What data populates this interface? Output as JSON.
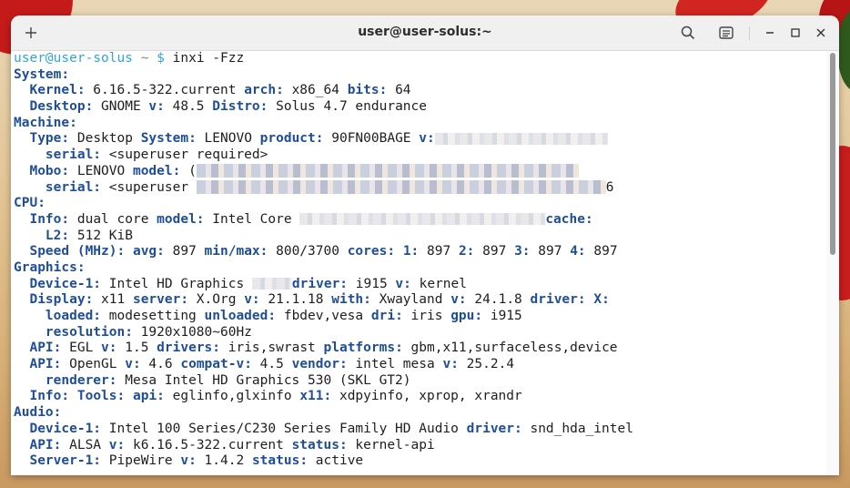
{
  "window": {
    "title": "user@user-solus:~"
  },
  "prompt": {
    "user": "user",
    "host": "user-solus",
    "path": "~",
    "symbol": "$",
    "command": "inxi -Fzz"
  },
  "lines": [
    [
      [
        "k",
        "System:"
      ]
    ],
    [
      [
        "t",
        "  "
      ],
      [
        "k",
        "Kernel:"
      ],
      [
        "t",
        " 6.16.5-322.current "
      ],
      [
        "k",
        "arch:"
      ],
      [
        "t",
        " x86_64 "
      ],
      [
        "k",
        "bits:"
      ],
      [
        "t",
        " 64"
      ]
    ],
    [
      [
        "t",
        "  "
      ],
      [
        "k",
        "Desktop:"
      ],
      [
        "t",
        " GNOME "
      ],
      [
        "k",
        "v:"
      ],
      [
        "t",
        " 48.5 "
      ],
      [
        "k",
        "Distro:"
      ],
      [
        "t",
        " Solus 4.7 endurance"
      ]
    ],
    [
      [
        "k",
        "Machine:"
      ]
    ],
    [
      [
        "t",
        "  "
      ],
      [
        "k",
        "Type:"
      ],
      [
        "t",
        " Desktop "
      ],
      [
        "k",
        "System:"
      ],
      [
        "t",
        " LENOVO "
      ],
      [
        "k",
        "product:"
      ],
      [
        "t",
        " 90FN00BAGE "
      ],
      [
        "k",
        "v:"
      ],
      [
        "b",
        "190"
      ]
    ],
    [
      [
        "t",
        "    "
      ],
      [
        "k",
        "serial:"
      ],
      [
        "t",
        " <superuser required>"
      ]
    ],
    [
      [
        "t",
        "  "
      ],
      [
        "k",
        "Mobo:"
      ],
      [
        "t",
        " LENOVO "
      ],
      [
        "k",
        "model:"
      ],
      [
        "t",
        " ("
      ],
      [
        "b2",
        "420"
      ]
    ],
    [
      [
        "t",
        "    "
      ],
      [
        "k",
        "serial:"
      ],
      [
        "t",
        " <superuser "
      ],
      [
        "b2",
        "450"
      ],
      [
        "t",
        "6"
      ]
    ],
    [
      [
        "k",
        "CPU:"
      ]
    ],
    [
      [
        "t",
        "  "
      ],
      [
        "k",
        "Info:"
      ],
      [
        "t",
        " dual core "
      ],
      [
        "k",
        "model:"
      ],
      [
        "t",
        " Intel Core "
      ],
      [
        "b",
        "270"
      ],
      [
        "k",
        "cache:"
      ]
    ],
    [
      [
        "t",
        "    "
      ],
      [
        "k",
        "L2:"
      ],
      [
        "t",
        " 512 KiB"
      ]
    ],
    [
      [
        "t",
        "  "
      ],
      [
        "k",
        "Speed (MHz):"
      ],
      [
        "t",
        " "
      ],
      [
        "k",
        "avg:"
      ],
      [
        "t",
        " 897 "
      ],
      [
        "k",
        "min/max:"
      ],
      [
        "t",
        " 800/3700 "
      ],
      [
        "k",
        "cores:"
      ],
      [
        "t",
        " "
      ],
      [
        "k",
        "1:"
      ],
      [
        "t",
        " 897 "
      ],
      [
        "k",
        "2:"
      ],
      [
        "t",
        " 897 "
      ],
      [
        "k",
        "3:"
      ],
      [
        "t",
        " 897 "
      ],
      [
        "k",
        "4:"
      ],
      [
        "t",
        " 897"
      ]
    ],
    [
      [
        "k",
        "Graphics:"
      ]
    ],
    [
      [
        "t",
        "  "
      ],
      [
        "k",
        "Device-1:"
      ],
      [
        "t",
        " Intel HD Graphics "
      ],
      [
        "b",
        "44"
      ],
      [
        "k",
        "driver:"
      ],
      [
        "t",
        " i915 "
      ],
      [
        "k",
        "v:"
      ],
      [
        "t",
        " kernel"
      ]
    ],
    [
      [
        "t",
        "  "
      ],
      [
        "k",
        "Display:"
      ],
      [
        "t",
        " x11 "
      ],
      [
        "k",
        "server:"
      ],
      [
        "t",
        " X.Org "
      ],
      [
        "k",
        "v:"
      ],
      [
        "t",
        " 21.1.18 "
      ],
      [
        "k",
        "with:"
      ],
      [
        "t",
        " Xwayland "
      ],
      [
        "k",
        "v:"
      ],
      [
        "t",
        " 24.1.8 "
      ],
      [
        "k",
        "driver:"
      ],
      [
        "t",
        " "
      ],
      [
        "k",
        "X:"
      ]
    ],
    [
      [
        "t",
        "    "
      ],
      [
        "k",
        "loaded:"
      ],
      [
        "t",
        " modesetting "
      ],
      [
        "k",
        "unloaded:"
      ],
      [
        "t",
        " fbdev,vesa "
      ],
      [
        "k",
        "dri:"
      ],
      [
        "t",
        " iris "
      ],
      [
        "k",
        "gpu:"
      ],
      [
        "t",
        " i915"
      ]
    ],
    [
      [
        "t",
        "    "
      ],
      [
        "k",
        "resolution:"
      ],
      [
        "t",
        " 1920x1080~60Hz"
      ]
    ],
    [
      [
        "t",
        "  "
      ],
      [
        "k",
        "API:"
      ],
      [
        "t",
        " EGL "
      ],
      [
        "k",
        "v:"
      ],
      [
        "t",
        " 1.5 "
      ],
      [
        "k",
        "drivers:"
      ],
      [
        "t",
        " iris,swrast "
      ],
      [
        "k",
        "platforms:"
      ],
      [
        "t",
        " gbm,x11,surfaceless,device"
      ]
    ],
    [
      [
        "t",
        "  "
      ],
      [
        "k",
        "API:"
      ],
      [
        "t",
        " OpenGL "
      ],
      [
        "k",
        "v:"
      ],
      [
        "t",
        " 4.6 "
      ],
      [
        "k",
        "compat-v:"
      ],
      [
        "t",
        " 4.5 "
      ],
      [
        "k",
        "vendor:"
      ],
      [
        "t",
        " intel mesa "
      ],
      [
        "k",
        "v:"
      ],
      [
        "t",
        " 25.2.4"
      ]
    ],
    [
      [
        "t",
        "    "
      ],
      [
        "k",
        "renderer:"
      ],
      [
        "t",
        " Mesa Intel HD Graphics 530 (SKL GT2)"
      ]
    ],
    [
      [
        "t",
        "  "
      ],
      [
        "k",
        "Info:"
      ],
      [
        "t",
        " "
      ],
      [
        "k",
        "Tools:"
      ],
      [
        "t",
        " "
      ],
      [
        "k",
        "api:"
      ],
      [
        "t",
        " eglinfo,glxinfo "
      ],
      [
        "k",
        "x11:"
      ],
      [
        "t",
        " xdpyinfo, xprop, xrandr"
      ]
    ],
    [
      [
        "k",
        "Audio:"
      ]
    ],
    [
      [
        "t",
        "  "
      ],
      [
        "k",
        "Device-1:"
      ],
      [
        "t",
        " Intel 100 Series/C230 Series Family HD Audio "
      ],
      [
        "k",
        "driver:"
      ],
      [
        "t",
        " snd_hda_intel"
      ]
    ],
    [
      [
        "t",
        "  "
      ],
      [
        "k",
        "API:"
      ],
      [
        "t",
        " ALSA "
      ],
      [
        "k",
        "v:"
      ],
      [
        "t",
        " k6.16.5-322.current "
      ],
      [
        "k",
        "status:"
      ],
      [
        "t",
        " kernel-api"
      ]
    ],
    [
      [
        "t",
        "  "
      ],
      [
        "k",
        "Server-1:"
      ],
      [
        "t",
        " PipeWire "
      ],
      [
        "k",
        "v:"
      ],
      [
        "t",
        " 1.4.2 "
      ],
      [
        "k",
        "status:"
      ],
      [
        "t",
        " active"
      ]
    ]
  ],
  "icons": {
    "new_tab": "plus-icon",
    "search": "search-icon",
    "menu": "hamburger-menu-icon",
    "minimize": "minimize-icon",
    "maximize": "maximize-icon",
    "close": "close-icon"
  },
  "colors": {
    "key": "#1f4e99",
    "user": "#33a5d6",
    "text": "#1e1e1e",
    "titlebar": "#f0f0f0"
  }
}
